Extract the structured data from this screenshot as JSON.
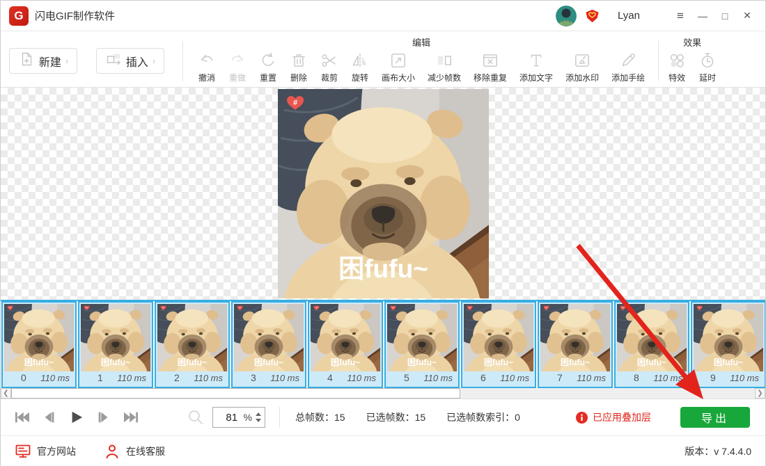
{
  "titlebar": {
    "app_title": "闪电GIF制作软件",
    "username": "Lyan",
    "menu_glyph": "≡",
    "minimize_glyph": "—",
    "maximize_glyph": "□",
    "close_glyph": "✕"
  },
  "toolbar": {
    "new_label": "新建",
    "insert_label": "插入",
    "button_chevron": "›",
    "edit_group_label": "编辑",
    "effects_group_label": "效果",
    "tools": [
      {
        "name": "undo",
        "label": "撤消",
        "icon": "undo-icon",
        "enabled": true
      },
      {
        "name": "redo",
        "label": "重做",
        "icon": "redo-icon",
        "enabled": false
      },
      {
        "name": "reset",
        "label": "重置",
        "icon": "reset-icon",
        "enabled": true
      },
      {
        "name": "delete",
        "label": "删除",
        "icon": "trash-icon",
        "enabled": true
      },
      {
        "name": "crop",
        "label": "裁剪",
        "icon": "scissors-icon",
        "enabled": true
      },
      {
        "name": "rotate",
        "label": "旋转",
        "icon": "flip-icon",
        "enabled": true
      },
      {
        "name": "canvas-size",
        "label": "画布大小",
        "icon": "canvas-size-icon",
        "enabled": true
      },
      {
        "name": "reduce-frames",
        "label": "减少帧数",
        "icon": "reduce-frames-icon",
        "enabled": true
      },
      {
        "name": "remove-duplicates",
        "label": "移除重复",
        "icon": "remove-duplicate-icon",
        "enabled": true
      },
      {
        "name": "add-text",
        "label": "添加文字",
        "icon": "add-text-icon",
        "enabled": true
      },
      {
        "name": "add-watermark",
        "label": "添加水印",
        "icon": "watermark-icon",
        "enabled": true
      },
      {
        "name": "add-drawing",
        "label": "添加手绘",
        "icon": "pencil-icon",
        "enabled": true
      }
    ],
    "effects_tools": [
      {
        "name": "effects",
        "label": "特效",
        "icon": "effects-icon",
        "enabled": true
      },
      {
        "name": "delay",
        "label": "延时",
        "icon": "delay-icon",
        "enabled": true
      }
    ]
  },
  "canvas": {
    "overlay_text": "困fufu~",
    "sticker_glyph": "#"
  },
  "timeline": {
    "scroll_left_glyph": "❮",
    "scroll_right_glyph": "❯",
    "frames": [
      {
        "index": "0",
        "duration": "110 ms",
        "selected": true
      },
      {
        "index": "1",
        "duration": "110 ms",
        "selected": true
      },
      {
        "index": "2",
        "duration": "110 ms",
        "selected": true
      },
      {
        "index": "3",
        "duration": "110 ms",
        "selected": true
      },
      {
        "index": "4",
        "duration": "110 ms",
        "selected": true
      },
      {
        "index": "5",
        "duration": "110 ms",
        "selected": true
      },
      {
        "index": "6",
        "duration": "110 ms",
        "selected": true
      },
      {
        "index": "7",
        "duration": "110 ms",
        "selected": true
      },
      {
        "index": "8",
        "duration": "110 ms",
        "selected": true
      },
      {
        "index": "9",
        "duration": "110 ms",
        "selected": true
      }
    ]
  },
  "controls": {
    "playback": [
      {
        "name": "first-frame"
      },
      {
        "name": "prev-frame"
      },
      {
        "name": "play"
      },
      {
        "name": "next-frame"
      },
      {
        "name": "last-frame"
      }
    ],
    "zoom_value": "81",
    "zoom_unit": "%",
    "stats": [
      {
        "name": "total-frames",
        "label": "总帧数：",
        "value": "15"
      },
      {
        "name": "selected-frames",
        "label": "已选帧数：",
        "value": "15"
      },
      {
        "name": "selected-frame-index",
        "label": "已选帧数索引：",
        "value": "0"
      }
    ],
    "warning": "已应用叠加层",
    "export_label": "导出"
  },
  "footer": {
    "website": "官方网站",
    "support": "在线客服",
    "version_label": "版本：",
    "version_value": "v 7.4.4.0"
  },
  "colors": {
    "accent_red": "#e0251b",
    "export_green": "#17a73a",
    "timeline_blue": "#35aee3",
    "frame_bg": "#cdeaf9"
  }
}
